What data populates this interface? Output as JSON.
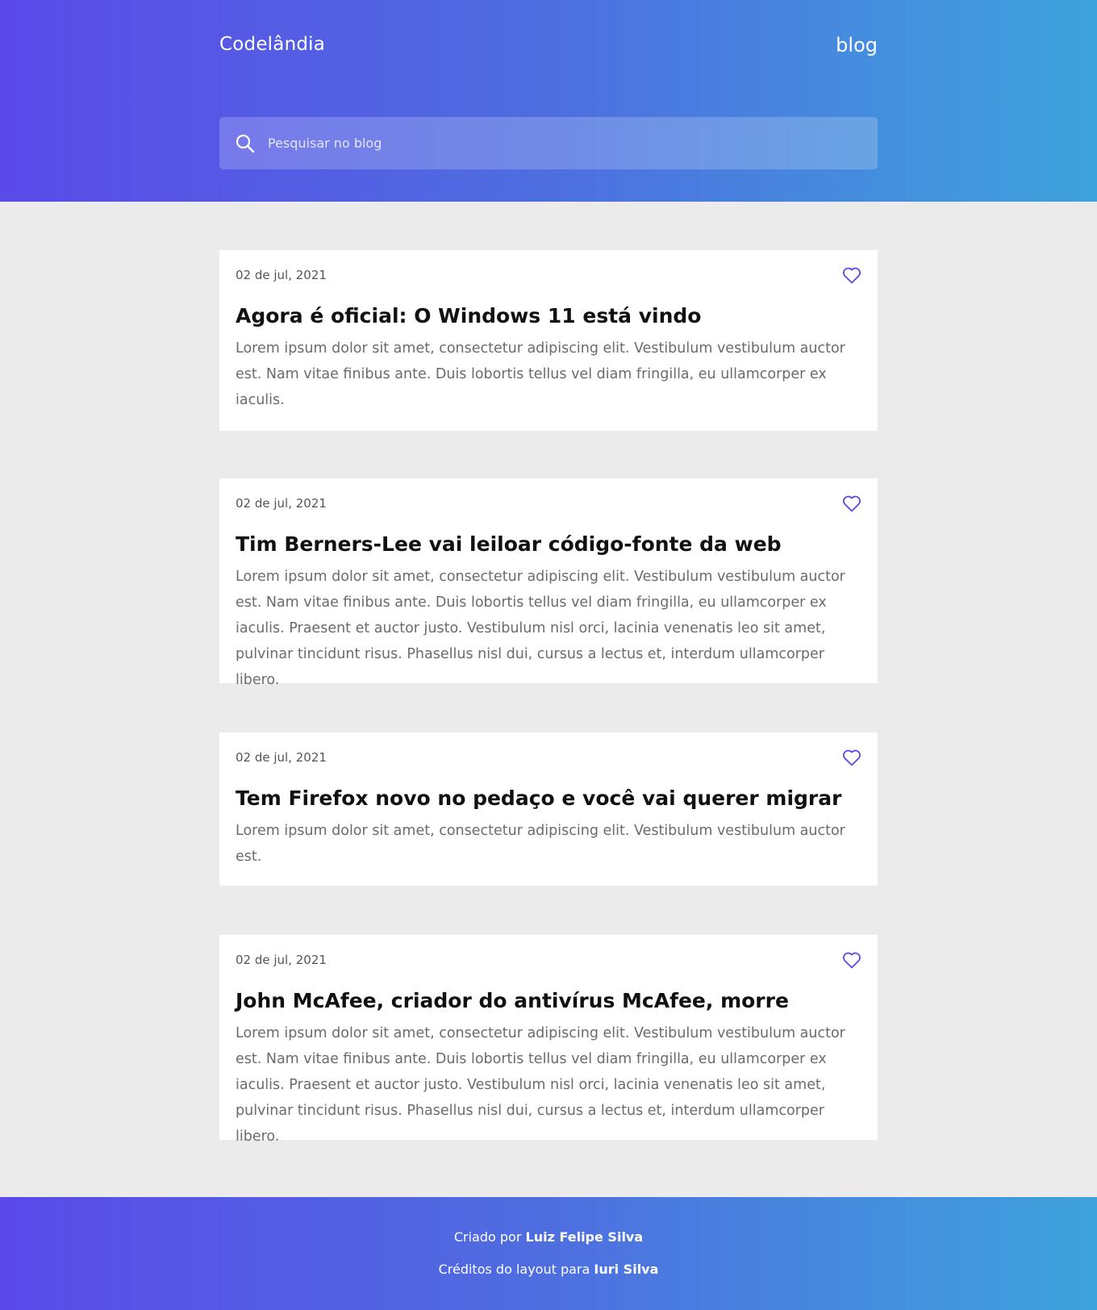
{
  "header": {
    "brand": "Codelândia",
    "nav_link": "blog",
    "search": {
      "placeholder": "Pesquisar no blog",
      "icon": "search-icon"
    }
  },
  "posts": [
    {
      "date": "02 de jul, 2021",
      "title": "Agora é oficial: O Windows 11 está vindo",
      "excerpt": "Lorem ipsum dolor sit amet, consectetur adipiscing elit. Vestibulum vestibulum auctor est. Nam vitae finibus ante. Duis lobortis tellus vel diam fringilla, eu ullamcorper ex iaculis.",
      "favorite_icon": "heart-outline-icon"
    },
    {
      "date": "02 de jul, 2021",
      "title": "Tim Berners-Lee vai leiloar código-fonte da web",
      "excerpt": "Lorem ipsum dolor sit amet, consectetur adipiscing elit. Vestibulum vestibulum auctor est. Nam vitae finibus ante. Duis lobortis tellus vel diam fringilla, eu ullamcorper ex iaculis. Praesent et auctor justo. Vestibulum nisl orci, lacinia venenatis leo sit amet, pulvinar tincidunt risus. Phasellus nisl dui, cursus a lectus et, interdum ullamcorper libero.",
      "favorite_icon": "heart-outline-icon"
    },
    {
      "date": "02 de jul, 2021",
      "title": "Tem Firefox novo no pedaço e você vai querer migrar",
      "excerpt": "Lorem ipsum dolor sit amet, consectetur adipiscing elit. Vestibulum vestibulum auctor est.",
      "favorite_icon": "heart-outline-icon"
    },
    {
      "date": "02 de jul, 2021",
      "title": "John McAfee, criador do antivírus McAfee, morre",
      "excerpt": "Lorem ipsum dolor sit amet, consectetur adipiscing elit. Vestibulum vestibulum auctor est. Nam vitae finibus ante. Duis lobortis tellus vel diam fringilla, eu ullamcorper ex iaculis. Praesent et auctor justo. Vestibulum nisl orci, lacinia venenatis leo sit amet, pulvinar tincidunt risus. Phasellus nisl dui, cursus a lectus et, interdum ullamcorper libero.",
      "favorite_icon": "heart-outline-icon"
    }
  ],
  "footer": {
    "created_prefix": "Criado por",
    "created_name": "Luiz Felipe Silva",
    "credits_prefix": "Créditos do layout para",
    "credits_name": "Iuri Silva"
  },
  "colors": {
    "gradient_start": "#5a4ae8",
    "gradient_end": "#3ea3dc",
    "accent": "#5a4ae8",
    "background": "#ebebeb"
  }
}
